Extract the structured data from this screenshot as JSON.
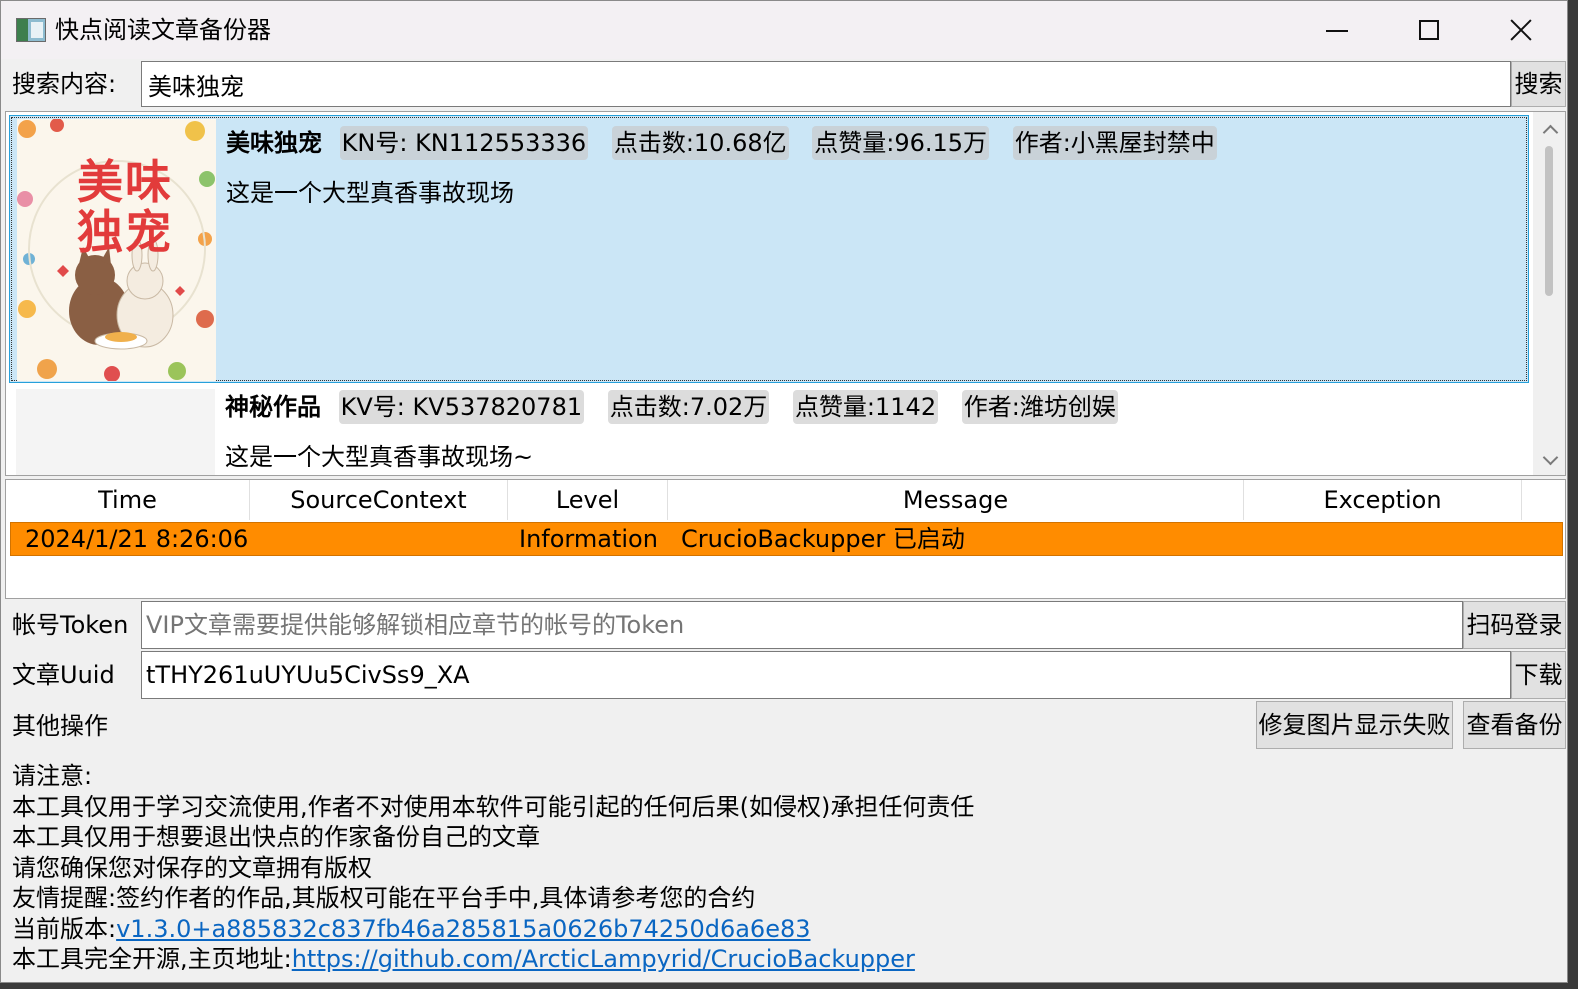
{
  "window": {
    "title": "快点阅读文章备份器",
    "minimize_icon": "minimize-icon",
    "maximize_icon": "maximize-icon",
    "close_icon": "close-icon"
  },
  "search": {
    "label": "搜索内容:",
    "value": "美味独宠",
    "button_label": "搜索"
  },
  "results": [
    {
      "title": "美味独宠",
      "id_label": "KN号:",
      "id_value": "KN112553336",
      "clicks": "点击数:10.68亿",
      "likes": "点赞量:96.15万",
      "author": "作者:小黑屋封禁中",
      "description": "这是一个大型真香事故现场",
      "cover_text": "美味独宠",
      "selected": true
    },
    {
      "title": "神秘作品",
      "id_label": "KV号:",
      "id_value": "KV537820781",
      "clicks": "点击数:7.02万",
      "likes": "点赞量:1142",
      "author": "作者:潍坊创娱",
      "description": "这是一个大型真香事故现场~",
      "selected": false
    }
  ],
  "log_grid": {
    "columns": [
      "Time",
      "SourceContext",
      "Level",
      "Message",
      "Exception"
    ],
    "rows": [
      {
        "time": "2024/1/21 8:26:06",
        "source_context": "",
        "level": "Information",
        "message": "CrucioBackupper 已启动",
        "exception": ""
      }
    ],
    "highlight_color": "#ff8c00"
  },
  "form": {
    "token_label": "帐号Token",
    "token_placeholder": "VIP文章需要提供能够解锁相应章节的帐号的Token",
    "scan_login_label": "扫码登录",
    "uuid_label": "文章Uuid",
    "uuid_value": "tTHY261uUYUu5CivSs9_XA",
    "download_label": "下载",
    "other_ops_label": "其他操作",
    "fix_images_label": "修复图片显示失败",
    "view_backup_label": "查看备份"
  },
  "notes": {
    "heading": "请注意:",
    "line1": "本工具仅用于学习交流使用,作者不对使用本软件可能引起的任何后果(如侵权)承担任何责任",
    "line2": "本工具仅用于想要退出快点的作家备份自己的文章",
    "line3": "请您确保您对保存的文章拥有版权",
    "line4": "友情提醒:签约作者的作品,其版权可能在平台手中,具体请参考您的合约",
    "version_prefix": "当前版本:",
    "version_link": "v1.3.0+a885832c837fb46a285815a0626b74250d6a6e83",
    "homepage_prefix": "本工具完全开源,主页地址:",
    "homepage_link": "https://github.com/ArcticLampyrid/CrucioBackupper"
  },
  "colors": {
    "selection_bg": "#cbe6f6",
    "selection_border": "#26a0da",
    "link": "#0a66c2",
    "log_highlight": "#ff8c00"
  }
}
